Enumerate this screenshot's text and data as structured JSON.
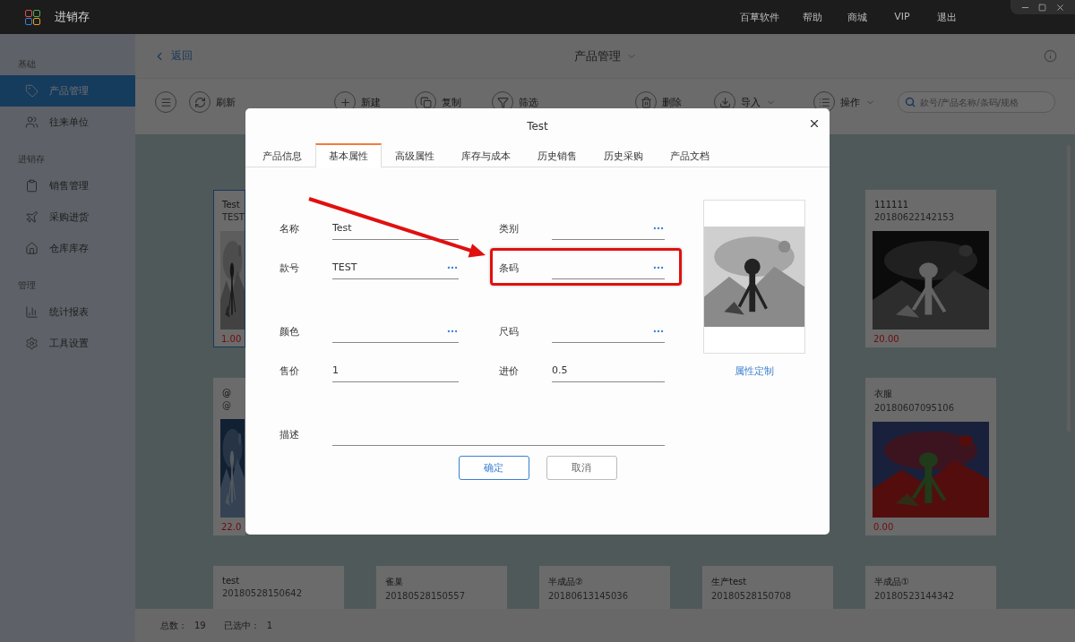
{
  "title_bar": {
    "app_name": "进销存",
    "nav": [
      "百草软件",
      "帮助",
      "商城",
      "VIP",
      "退出"
    ]
  },
  "sidebar": {
    "sections": [
      {
        "title": "基础",
        "items": [
          {
            "label": "产品管理",
            "selected": true
          },
          {
            "label": "往来单位",
            "selected": false
          }
        ]
      },
      {
        "title": "进销存",
        "items": [
          {
            "label": "销售管理",
            "selected": false
          },
          {
            "label": "采购进货",
            "selected": false
          },
          {
            "label": "仓库库存",
            "selected": false
          }
        ]
      },
      {
        "title": "管理",
        "items": [
          {
            "label": "统计报表",
            "selected": false
          },
          {
            "label": "工具设置",
            "selected": false
          }
        ]
      }
    ]
  },
  "header": {
    "back": "返回",
    "title": "产品管理"
  },
  "toolbar": {
    "items": [
      {
        "label": "刷新",
        "dropdown": false
      },
      {
        "label": "新建",
        "dropdown": false
      },
      {
        "label": "复制",
        "dropdown": false
      },
      {
        "label": "筛选",
        "dropdown": false
      },
      {
        "label": "删除",
        "dropdown": false
      },
      {
        "label": "导入",
        "dropdown": true
      },
      {
        "label": "操作",
        "dropdown": true
      }
    ],
    "search": {
      "placeholder": "款号/产品名称/条码/规格"
    }
  },
  "products": {
    "rows": [
      [
        {
          "name": "Test",
          "code": "TEST",
          "price": "1.00",
          "selected": true
        },
        {
          "name": "111111",
          "code": "20180622142153",
          "price": "20.00",
          "selected": false
        }
      ],
      [
        {
          "name": "@",
          "code": "@",
          "price": "22.0",
          "selected": false
        },
        {
          "name": "衣服",
          "code": "20180607095106",
          "price": "0.00",
          "selected": false
        }
      ],
      [
        {
          "name": "test",
          "code": "20180528150642",
          "selected": false
        },
        {
          "name": "雀巢",
          "code": "20180528150557",
          "selected": false
        },
        {
          "name": "半成品②",
          "code": "20180613145036",
          "selected": false
        },
        {
          "name": "生产test",
          "code": "20180528150708",
          "selected": false
        },
        {
          "name": "半成品①",
          "code": "20180523144342",
          "selected": false
        }
      ]
    ]
  },
  "status_bar": {
    "total_label": "总数：",
    "total": "19",
    "selected_label": "已选中：",
    "selected_count": "1"
  },
  "dialog": {
    "title": "Test",
    "tabs": [
      {
        "label": "产品信息",
        "selected": false
      },
      {
        "label": "基本属性",
        "selected": true
      },
      {
        "label": "高级属性",
        "selected": false
      },
      {
        "label": "库存与成本",
        "selected": false
      },
      {
        "label": "历史销售",
        "selected": false
      },
      {
        "label": "历史采购",
        "selected": false
      },
      {
        "label": "产品文档",
        "selected": false
      }
    ],
    "form_groups": [
      [
        {
          "label": "名称",
          "value": "Test",
          "picker": false,
          "highlighted": false
        },
        {
          "label": "类别",
          "picker": true,
          "highlighted": false
        },
        {
          "label": "款号",
          "value": "TEST",
          "picker": true,
          "highlighted": false
        },
        {
          "label": "条码",
          "picker": true,
          "highlighted": true
        }
      ],
      [
        {
          "label": "颜色",
          "picker": true,
          "highlighted": false
        },
        {
          "label": "尺码",
          "picker": true,
          "highlighted": false
        },
        {
          "label": "售价",
          "value": "1",
          "picker": false,
          "highlighted": false
        },
        {
          "label": "进价",
          "value": "0.5",
          "picker": false,
          "highlighted": false
        }
      ],
      [
        {
          "label": "描述",
          "picker": false,
          "highlighted": false,
          "wide": true
        }
      ]
    ],
    "image_link": "属性定制",
    "buttons": [
      {
        "label": "确定",
        "kind": "primary"
      },
      {
        "label": "取消",
        "kind": "secondary"
      }
    ]
  }
}
